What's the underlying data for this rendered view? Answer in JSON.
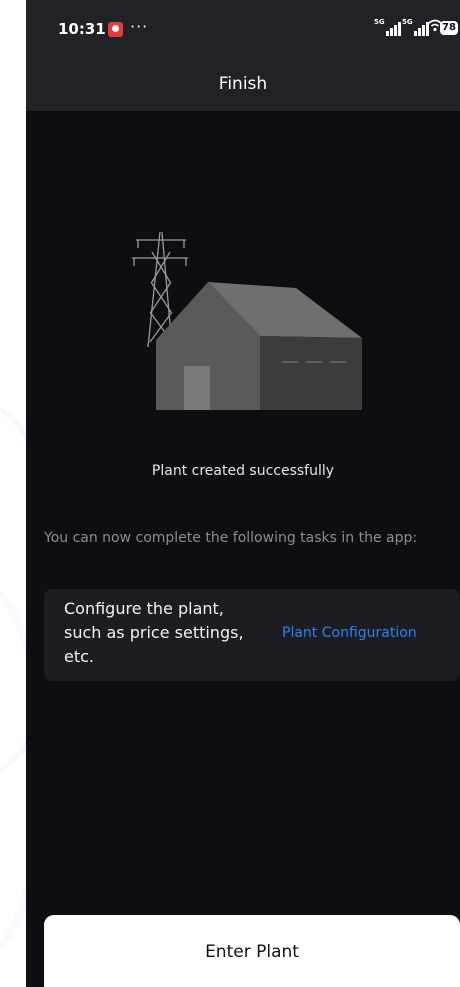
{
  "status_bar": {
    "time": "10:31",
    "more": "···",
    "sim1_label": "5G",
    "sim2_label": "5G",
    "battery": "78",
    "icons": [
      "app-notification-icon",
      "signal-5g-icon",
      "signal-5g-icon",
      "wifi-icon",
      "battery-icon"
    ]
  },
  "header": {
    "title": "Finish"
  },
  "illustration": {
    "icon": "power-plant-house-icon"
  },
  "content": {
    "success_message": "Plant created successfully",
    "tasks_intro": "You can now complete the following tasks in the app:",
    "tasks": [
      {
        "description": "Configure the plant, such as price settings, etc.",
        "action_label": "Plant Configuration"
      }
    ]
  },
  "footer": {
    "button_label": "Enter Plant"
  },
  "colors": {
    "background": "#0d0e12",
    "bar": "#202226",
    "card": "#1c1d22",
    "link": "#2f80ed",
    "muted_text": "#8a8c92"
  }
}
